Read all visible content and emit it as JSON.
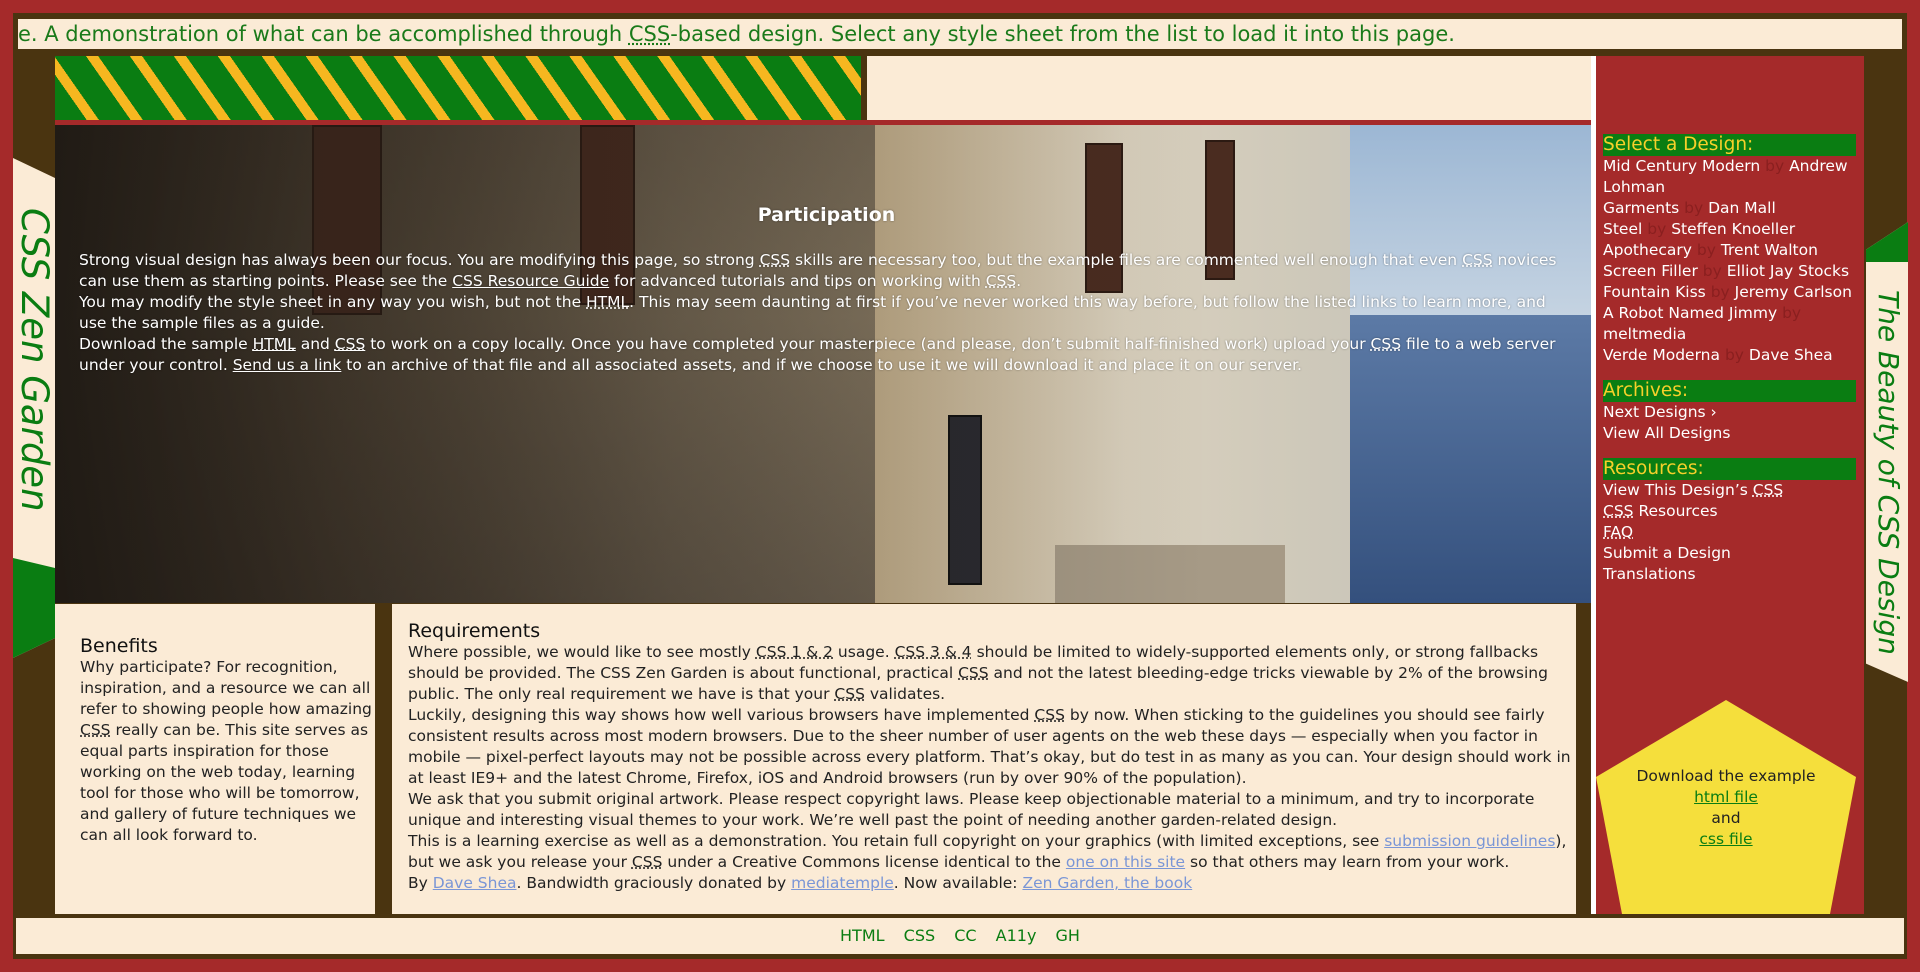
{
  "header": {
    "marquee_prefix": "e. A demonstration of what can be accomplished through ",
    "marquee_abbr": "CSS",
    "marquee_suffix": "-based design. Select any style sheet from the list to load it into this page."
  },
  "branding": {
    "left_title": "CSS Zen Garden",
    "right_title": "The Beauty of CSS Design"
  },
  "participation": {
    "title": "Participation",
    "p1_a": "Strong visual design has always been our focus. You are modifying this page, so strong ",
    "p1_b": " skills are necessary too, but the example files are commented well enough that even ",
    "p1_c": " novices can use them as starting points. Please see the ",
    "p1_link": "CSS Resource Guide",
    "p1_d": " for advanced tutorials and tips on working with ",
    "p1_e": ".",
    "p2_a": "You may modify the style sheet in any way you wish, but not the ",
    "p2_b": ". This may seem daunting at first if you’ve never worked this way before, but follow the listed links to learn more, and use the sample files as a guide.",
    "p3_a": "Download the sample ",
    "p3_html": "HTML",
    "p3_and": " and ",
    "p3_css": "CSS",
    "p3_b": " to work on a copy locally. Once you have completed your masterpiece (and please, don’t submit half-finished work) upload your ",
    "p3_c": " file to a web server under your control. ",
    "p3_link": "Send us a link",
    "p3_d": " to an archive of that file and all associated assets, and if we choose to use it we will download it and place it on our server.",
    "abbr_css": "CSS",
    "abbr_html": "HTML"
  },
  "benefits": {
    "title": "Benefits",
    "text_a": "Why participate? For recognition, inspiration, and a resource we can all refer to showing people how amazing ",
    "text_abbr": "CSS",
    "text_b": " really can be. This site serves as equal parts inspiration for those working on the web today, learning tool for those who will be tomorrow, and gallery of future techniques we can all look forward to."
  },
  "requirements": {
    "title": "Requirements",
    "r1_a": "Where possible, we would like to see mostly ",
    "r1_abbr1": "CSS 1 & 2",
    "r1_b": " usage. ",
    "r1_abbr2": "CSS 3 & 4",
    "r1_c": " should be limited to widely-supported elements only, or strong fallbacks should be provided. The CSS Zen Garden is about functional, practical ",
    "r1_d": " and not the latest bleeding-edge tricks viewable by 2% of the browsing public. The only real requirement we have is that your ",
    "r1_e": " validates.",
    "r2_a": "Luckily, designing this way shows how well various browsers have implemented ",
    "r2_b": " by now. When sticking to the guidelines you should see fairly consistent results across most modern browsers. Due to the sheer number of user agents on the web these days — especially when you factor in mobile — pixel-perfect layouts may not be possible across every platform. That’s okay, but do test in as many as you can. Your design should work in at least IE9+ and the latest Chrome, Firefox, iOS and Android browsers (run by over 90% of the population).",
    "r3": "We ask that you submit original artwork. Please respect copyright laws. Please keep objectionable material to a minimum, and try to incorporate unique and interesting visual themes to your work. We’re well past the point of needing another garden-related design.",
    "r4_a": "This is a learning exercise as well as a demonstration. You retain full copyright on your graphics (with limited exceptions, see ",
    "r4_link1": "submission guidelines",
    "r4_b": "), but we ask you release your ",
    "r4_c": " under a Creative Commons license identical to the ",
    "r4_link2": "one on this site",
    "r4_d": " so that others may learn from your work.",
    "r5_a": "By ",
    "r5_link1": "Dave Shea",
    "r5_b": ". Bandwidth graciously donated by ",
    "r5_link2": "mediatemple",
    "r5_c": ". Now available: ",
    "r5_link3": "Zen Garden, the book",
    "abbr_css": "CSS"
  },
  "sidebar": {
    "select_title": "Select a Design:",
    "by": "by",
    "designs": [
      {
        "name": "Mid Century Modern",
        "author": "Andrew Lohman"
      },
      {
        "name": "Garments",
        "author": "Dan Mall"
      },
      {
        "name": "Steel",
        "author": "Steffen Knoeller"
      },
      {
        "name": "Apothecary",
        "author": "Trent Walton"
      },
      {
        "name": "Screen Filler",
        "author": "Elliot Jay Stocks"
      },
      {
        "name": "Fountain Kiss",
        "author": "Jeremy Carlson"
      },
      {
        "name": "A Robot Named Jimmy",
        "author": "meltmedia"
      },
      {
        "name": "Verde Moderna",
        "author": "Dave Shea"
      }
    ],
    "archives_title": "Archives:",
    "next_designs": "Next Designs ›",
    "view_all": "View All Designs",
    "resources_title": "Resources:",
    "view_css_a": "View This Design’s ",
    "view_css_abbr": "CSS",
    "css_resources_abbr": "CSS",
    "css_resources": " Resources",
    "faq": "FAQ",
    "submit": "Submit a Design",
    "translations": "Translations"
  },
  "download": {
    "text": "Download the example",
    "html_file": "html file",
    "and": "and",
    "css_file": "css file"
  },
  "footer": {
    "links": [
      "HTML",
      "CSS",
      "CC",
      "A11y",
      "GH"
    ]
  }
}
